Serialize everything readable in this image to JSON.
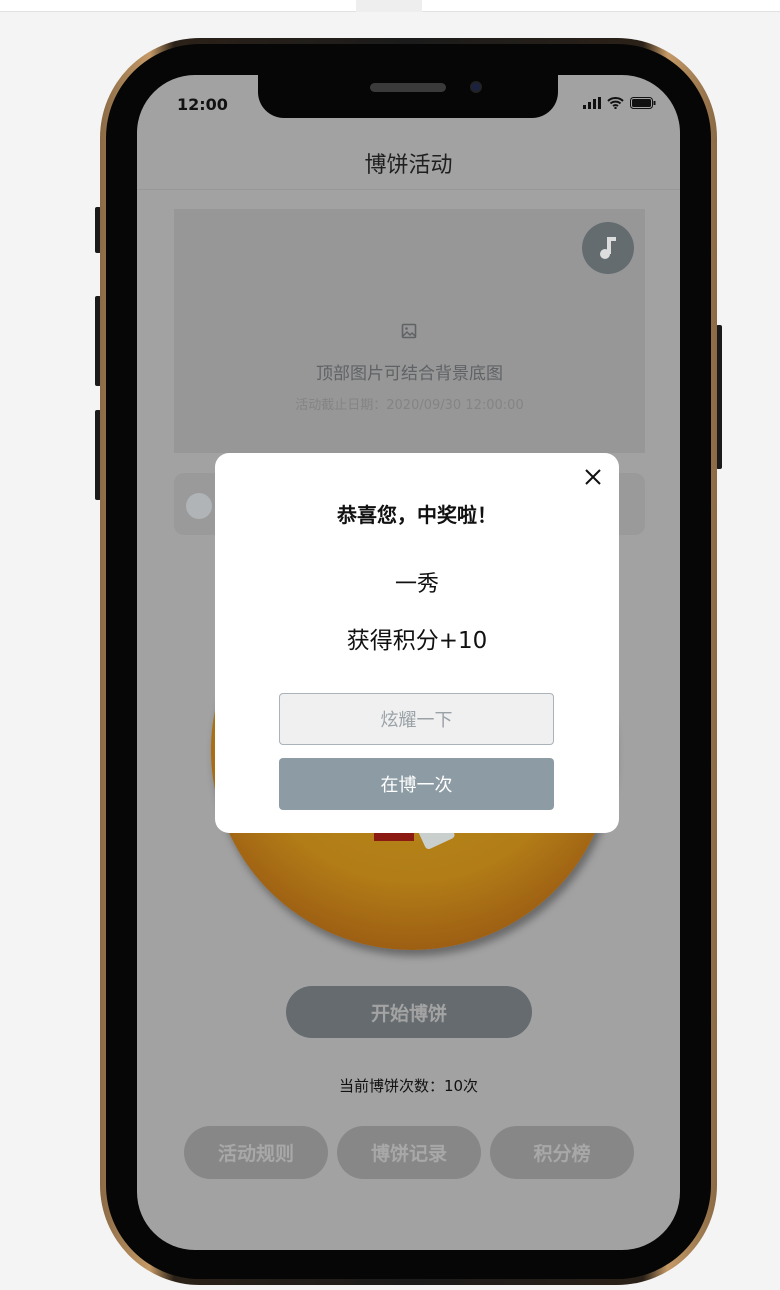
{
  "status_bar": {
    "time": "12:00"
  },
  "header": {
    "title": "博饼活动"
  },
  "banner": {
    "placeholder_text": "顶部图片可结合背景底图",
    "deadline": "活动截止日期：2020/09/30 12:00:00",
    "music_icon": "music-note-icon",
    "image_icon": "image-icon"
  },
  "game": {
    "start_label": "开始博饼",
    "count_text": "当前博饼次数：10次"
  },
  "bottom_buttons": [
    {
      "label": "活动规则"
    },
    {
      "label": "博饼记录"
    },
    {
      "label": "积分榜"
    }
  ],
  "modal": {
    "title": "恭喜您，中奖啦！",
    "prize": "一秀",
    "points": "获得积分+10",
    "show_off_label": "炫耀一下",
    "again_label": "在博一次"
  },
  "colors": {
    "overlay": "#a2a2a2",
    "primary_button": "#8d9ca4",
    "modal_bg": "#ffffff"
  }
}
